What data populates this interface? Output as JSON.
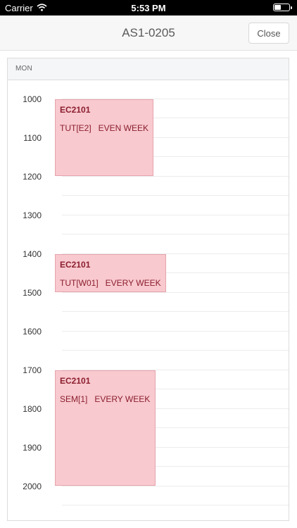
{
  "status_bar": {
    "carrier": "Carrier",
    "time": "5:53 PM"
  },
  "navbar": {
    "title": "AS1-0205",
    "close_label": "Close"
  },
  "day_header": "MON",
  "hours": [
    "1000",
    "1100",
    "1200",
    "1300",
    "1400",
    "1500",
    "1600",
    "1700",
    "1800",
    "1900",
    "2000"
  ],
  "events": [
    {
      "code": "EC2101",
      "detail": "TUT[E2]   EVEN WEEK"
    },
    {
      "code": "EC2101",
      "detail": "TUT[W01]   EVERY WEEK"
    },
    {
      "code": "EC2101",
      "detail": "SEM[1]   EVERY WEEK"
    }
  ]
}
